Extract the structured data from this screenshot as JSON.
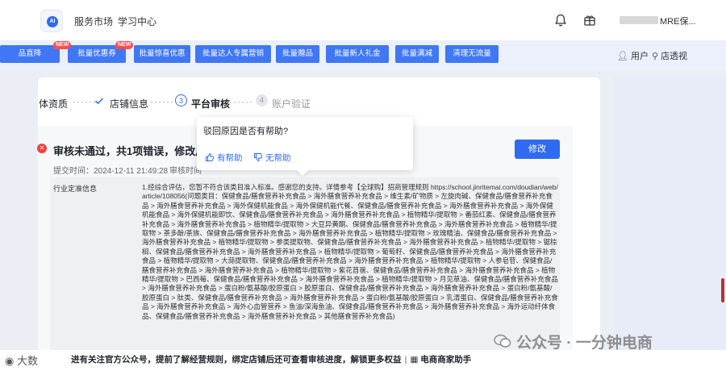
{
  "topbar": {
    "logo_text": "AI",
    "nav": [
      "服务市场",
      "学习中心"
    ],
    "user_suffix": "MRE保..."
  },
  "banner": {
    "buttons": [
      "品直降",
      "批量优惠券",
      "批量惊喜优惠",
      "批量达人专属营销",
      "批量赠品",
      "批量新人礼金",
      "批量满减",
      "清理无流量"
    ],
    "new_badge": "NEW",
    "right_links": [
      "用户",
      "店透视"
    ]
  },
  "steps": {
    "s1": "体资质",
    "s2": "店铺信息",
    "s3_num": "3",
    "s3": "平台审核",
    "s4_num": "4",
    "s4": "账户验证"
  },
  "review": {
    "title": "审核未通过，共1项错误，修改后需",
    "submit_time": "提交时间：2024-12-11 21:49:28",
    "review_time": "审核时间",
    "edit_button": "修改",
    "field_label": "行业定准信息",
    "detail": "1.经综合评估，您暂不符合该类目准入标准。感谢您的支持。详情参考【全球购】招商管理规则 https://school.jinritemai.com/doudian/web/article/108056(问题类目：保健食品/膳食营养补充食品 > 海外膳食营养补充食品 > 维生素/矿物质 > 左旋肉碱、保健食品/膳食营养补充食品 > 海外膳食营养补充食品 > 海外保健机能食品 > 海外保健机能代餐、保健食品/膳食营养补充食品 > 海外膳食营养补充食品 > 海外保健机能食品 > 海外保健机能即饮、保健食品/膳食营养补充食品 > 海外膳食营养补充食品 > 植物精华/提取物 > 番茄红素、保健食品/膳食营养补充食品 > 海外膳食营养补充食品 > 植物精华/提取物 > 大豆异黄酮、保健食品/膳食营养补充食品 > 海外膳食营养补充食品 > 植物精华/提取物 > 茶多酚/茶族、保健食品/膳食营养补充食品 > 海外膳食营养补充食品 > 植物精华/提取物 > 玫瑰精油、保健食品/膳食营养补充食品 > 海外膳食营养补充食品 > 植物精华/提取物 > 参类提取物、保健食品/膳食营养补充食品 > 海外膳食营养补充食品 > 植物精华/提取物 > 锯棕榈、保健食品/膳食营养补充食品 > 海外膳食营养补充食品 > 植物精华/提取物 > 葡萄籽、保健食品/膳食营养补充食品 > 海外膳食营养补充食品 > 植物精华/提取物 > 大蒜提取物、保健食品/膳食营养补充食品 > 海外膳食营养补充食品 > 植物精华/提取物 > 人参皂苷、保健食品/膳食营养补充食品 > 海外膳食营养补充食品 > 植物精华/提取物 > 紫花苜蓿、保健食品/膳食营养补充食品 > 海外膳食营养补充食品 > 植物精华/提取物 > 巴西莓、保健食品/膳食营养补充食品 > 海外膳食营养补充食品 > 植物精华/提取物 > 月见草油、保健食品/膳食营养补充食品 > 海外膳食营养补充食品 > 蛋白粉/氨基酸/胶原蛋白 > 胶原蛋白、保健食品/膳食营养补充食品 > 海外膳食营养补充食品 > 蛋白粉/氨基酸/胶原蛋白 > 肽类、保健食品/膳食营养补充食品 > 海外膳食营养补充食品 > 蛋白粉/氨基酸/胶原蛋白 > 乳清蛋白、保健食品/膳食营养补充食品 > 海外膳食营养补充食品 > 海外心血管营养 > 鱼油/深海鱼油、保健食品/膳食营养补充食品 > 海外膳食营养补充食品 > 海外运动纤体食品、保健食品/膳食营养补充食品 > 海外膳食营养补充食品 > 其他膳食营养补充食品)"
  },
  "popover": {
    "question": "驳回原因是否有帮助?",
    "yes": "有帮助",
    "no": "无帮助"
  },
  "footer": {
    "left_caption": "大数",
    "text": "进有关注官方公众号，提前了解经营规则，绑定店铺后还可查看审核进度，解锁更多权益",
    "sep": "|",
    "link": "电商商家助手"
  },
  "watermark": "公众号 · 一分钟电商",
  "colors": {
    "primary": "#2f6bf0",
    "error": "#f53f3f",
    "promo": "#3f77f5"
  }
}
